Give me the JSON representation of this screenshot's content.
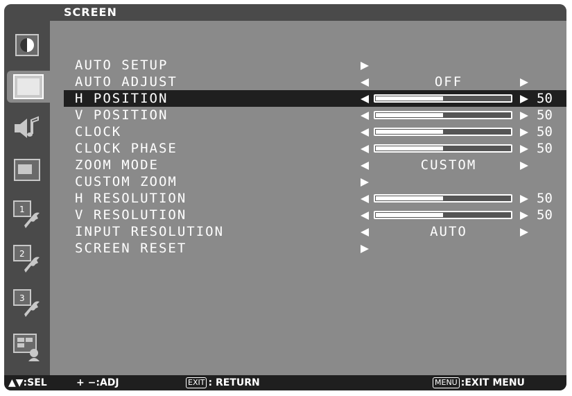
{
  "title": "SCREEN",
  "sidebar": {
    "icons": [
      {
        "name": "picture-icon"
      },
      {
        "name": "screen-icon",
        "selected": true
      },
      {
        "name": "audio-icon"
      },
      {
        "name": "pip-icon"
      },
      {
        "name": "setup-1-icon",
        "digit": "1"
      },
      {
        "name": "setup-2-icon",
        "digit": "2"
      },
      {
        "name": "setup-3-icon",
        "digit": "3"
      },
      {
        "name": "multi-input-icon"
      }
    ]
  },
  "menu": {
    "items": [
      {
        "label": "AUTO SETUP",
        "kind": "action"
      },
      {
        "label": "AUTO ADJUST",
        "kind": "option",
        "value": "OFF"
      },
      {
        "label": "H POSITION",
        "kind": "slider",
        "value": "50",
        "level": 0.5,
        "selected": true
      },
      {
        "label": "V POSITION",
        "kind": "slider",
        "value": "50",
        "level": 0.5
      },
      {
        "label": "CLOCK",
        "kind": "slider",
        "value": "50",
        "level": 0.5
      },
      {
        "label": "CLOCK PHASE",
        "kind": "slider",
        "value": "50",
        "level": 0.5
      },
      {
        "label": "ZOOM MODE",
        "kind": "option",
        "value": "CUSTOM"
      },
      {
        "label": "CUSTOM ZOOM",
        "kind": "action"
      },
      {
        "label": "H RESOLUTION",
        "kind": "slider",
        "value": "50",
        "level": 0.5
      },
      {
        "label": "V RESOLUTION",
        "kind": "slider",
        "value": "50",
        "level": 0.5
      },
      {
        "label": "INPUT RESOLUTION",
        "kind": "option",
        "value": "AUTO"
      },
      {
        "label": "SCREEN RESET",
        "kind": "action"
      }
    ]
  },
  "footer": {
    "sel": "SEL",
    "adj_keys": "+ −",
    "adj": "ADJ",
    "exit_key": "EXIT",
    "return": "RETURN",
    "menu_key": "MENU",
    "exit_menu": "EXIT MENU"
  },
  "colors": {
    "panel": "#8a8a8a",
    "dark": "#4a4a4a",
    "highlight": "#1f1f1f",
    "text": "#ffffff"
  }
}
